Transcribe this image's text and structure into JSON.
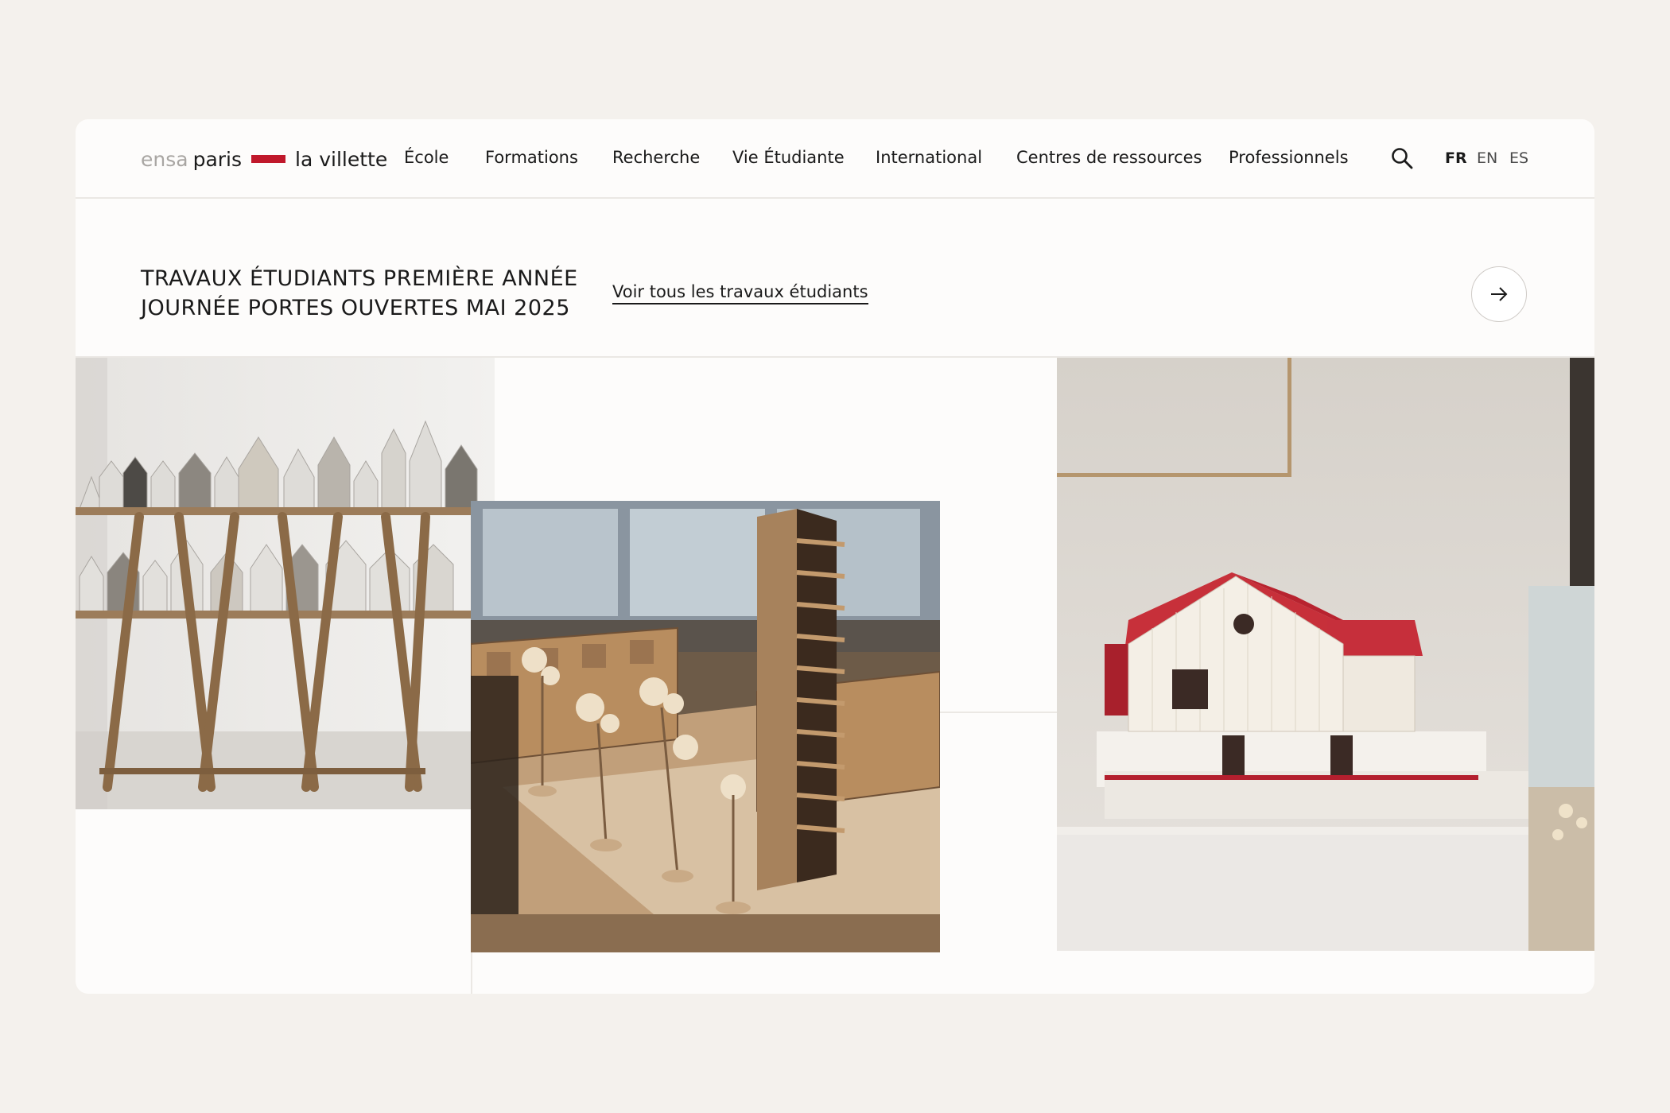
{
  "brand": {
    "logo_part1": "ensa",
    "logo_part2": "paris",
    "logo_part3": "la villette",
    "accent_color": "#c0182b"
  },
  "nav": {
    "items": [
      {
        "label": "École"
      },
      {
        "label": "Formations"
      },
      {
        "label": "Recherche"
      },
      {
        "label": "Vie Étudiante"
      },
      {
        "label": "International"
      },
      {
        "label": "Centres de ressources"
      },
      {
        "label": "Professionnels"
      }
    ],
    "search_icon": "search-icon",
    "languages": [
      {
        "label": "FR",
        "active": true
      },
      {
        "label": "EN",
        "active": false
      },
      {
        "label": "ES",
        "active": false
      }
    ]
  },
  "banner": {
    "title_line1": "TRAVAUX ÉTUDIANTS PREMIÈRE ANNÉE",
    "title_line2": "JOURNÉE PORTES OUVERTES MAI 2025",
    "link_label": "Voir tous les travaux étudiants",
    "arrow_icon": "arrow-right-icon"
  },
  "gallery": {
    "images": [
      {
        "name": "shelves-of-paper-house-models"
      },
      {
        "name": "cardboard-urban-model-with-tower"
      },
      {
        "name": "white-house-model-with-red-roof"
      },
      {
        "name": "partial-next-image"
      }
    ]
  }
}
